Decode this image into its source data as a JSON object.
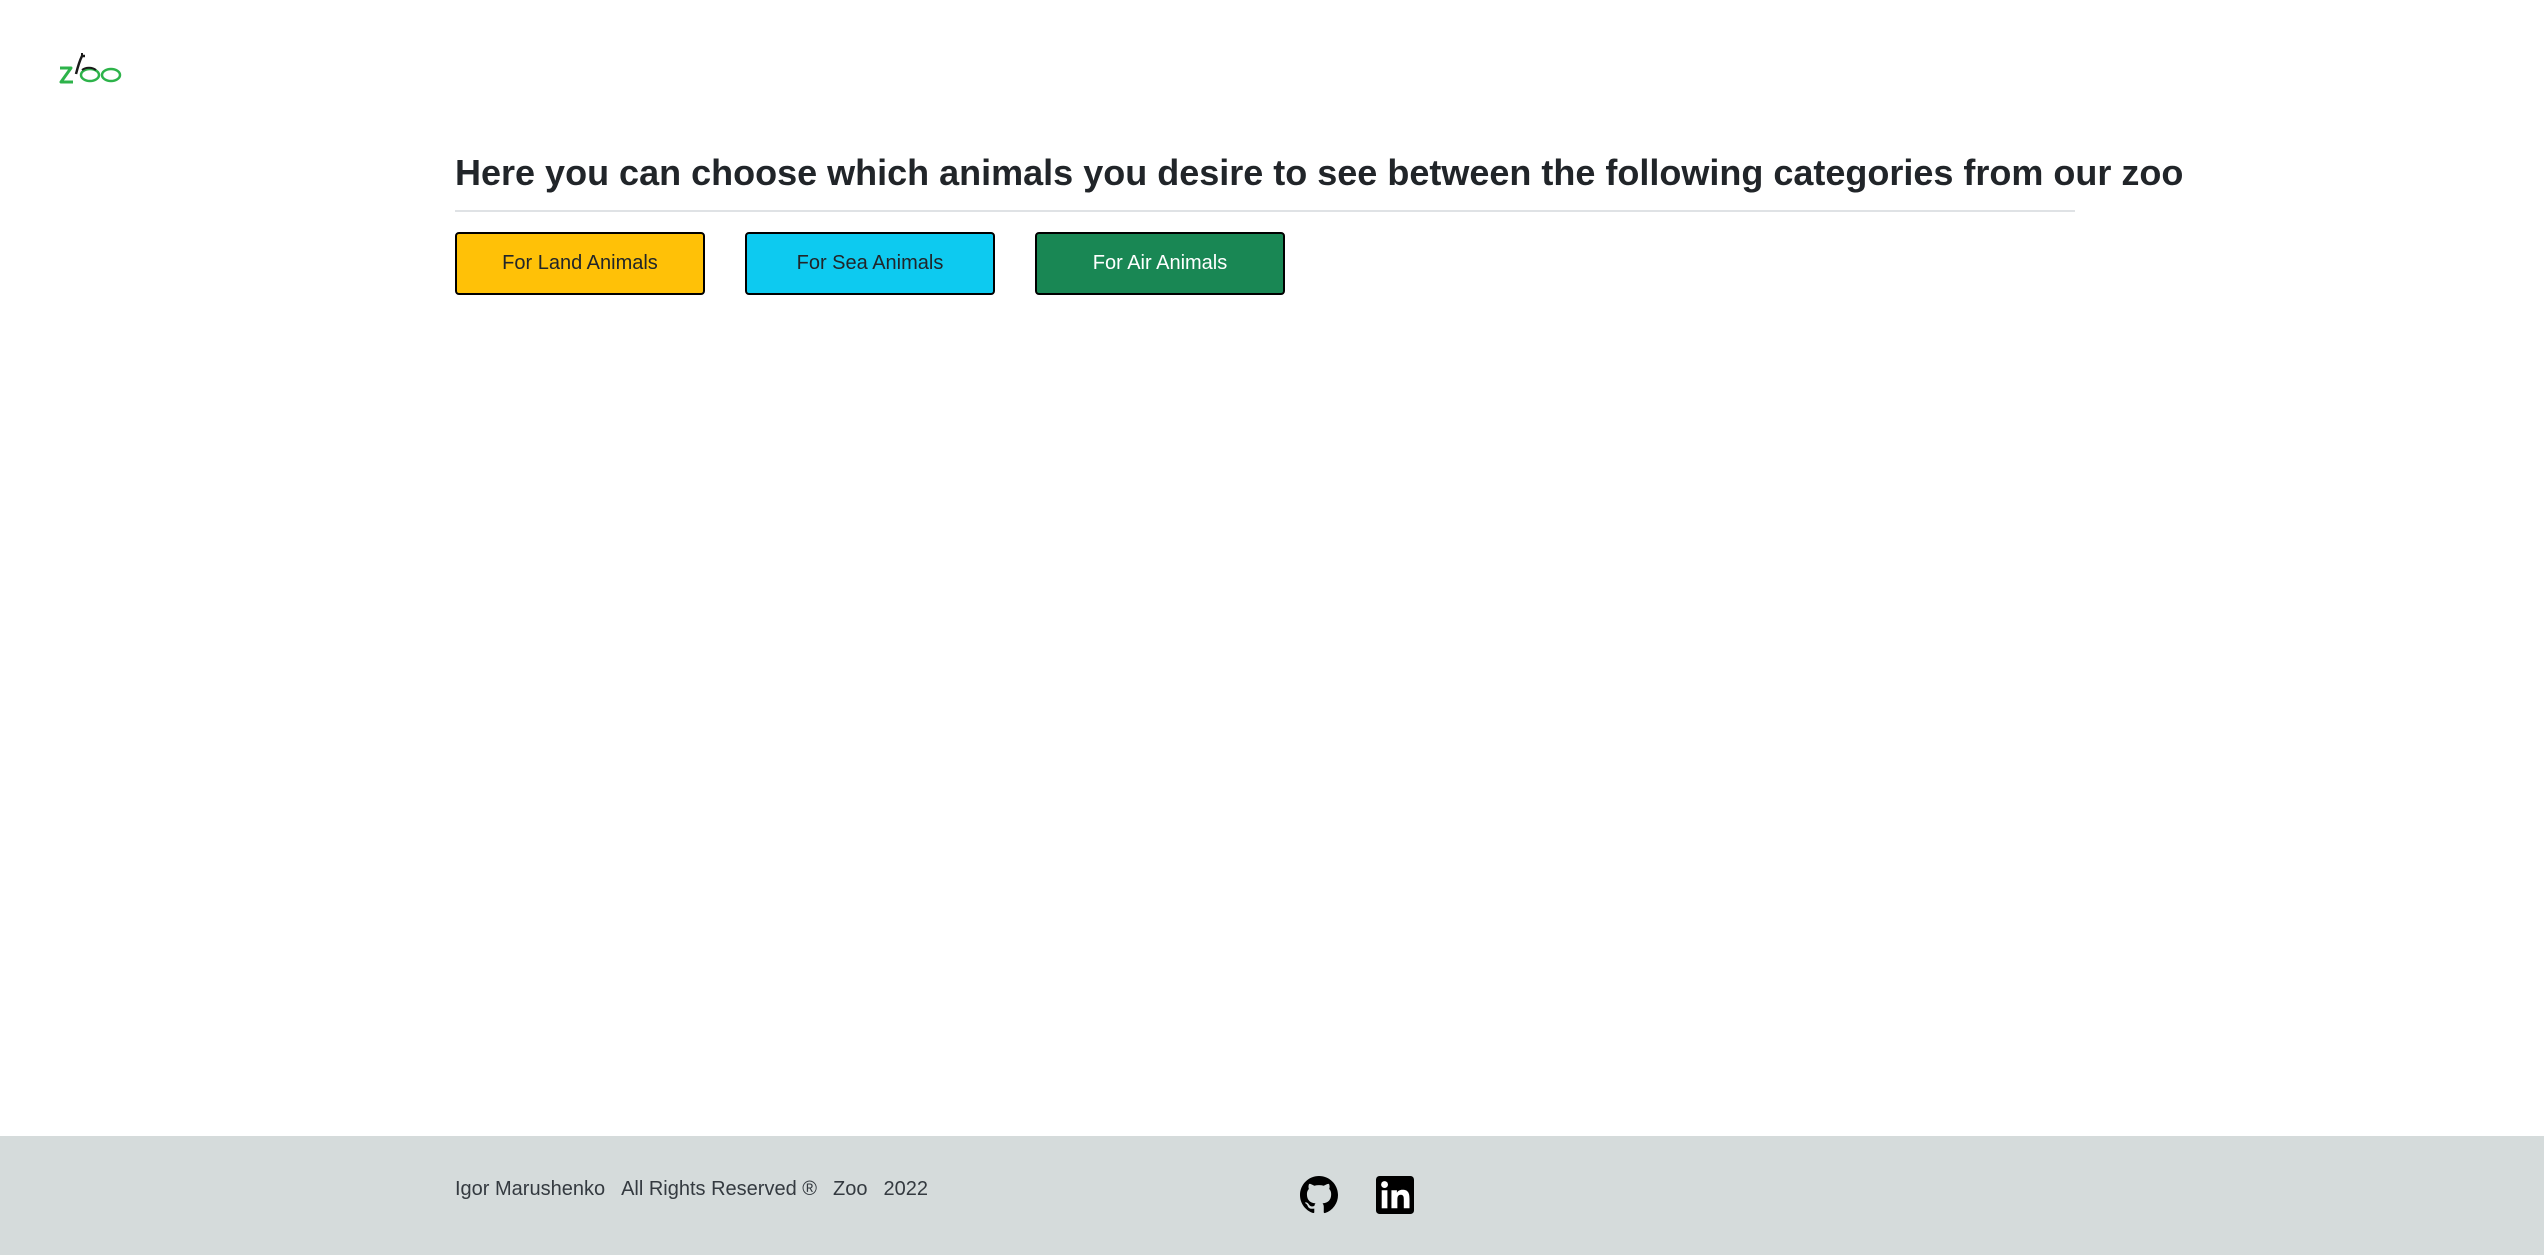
{
  "header": {
    "logo_text": "Zoo"
  },
  "main": {
    "heading": "Here you can choose which animals you desire to see between the following categories from our zoo",
    "buttons": {
      "land": "For Land Animals",
      "sea": "For Sea Animals",
      "air": "For Air Animals"
    }
  },
  "footer": {
    "author": "Igor Marushenko",
    "rights": "All Rights Reserved ®",
    "site": "Zoo",
    "year": "2022",
    "icons": [
      "github-icon",
      "linkedin-icon"
    ]
  },
  "colors": {
    "land_button": "#ffc107",
    "sea_button": "#0dcaf0",
    "air_button": "#198754",
    "footer_bg": "#d5dbdb",
    "logo_green": "#2db34a"
  }
}
